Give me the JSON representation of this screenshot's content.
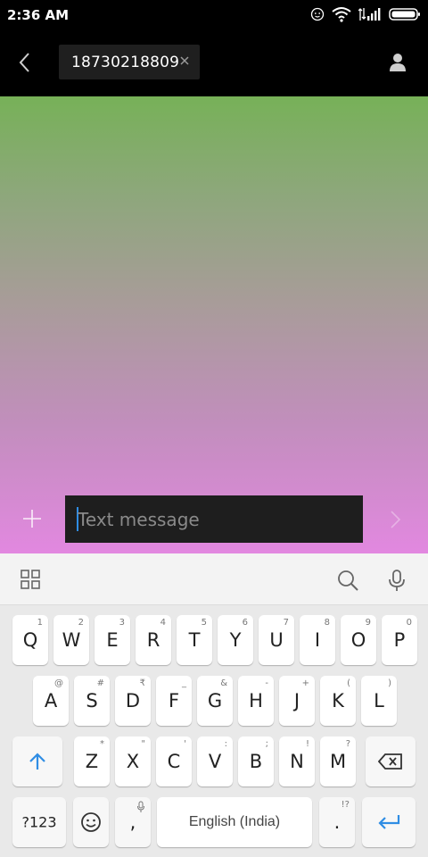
{
  "status_bar": {
    "time": "2:36 AM"
  },
  "header": {
    "recipient": "18730218809"
  },
  "composer": {
    "placeholder": "Text message"
  },
  "keyboard": {
    "row1": [
      {
        "label": "Q",
        "hint": "1"
      },
      {
        "label": "W",
        "hint": "2"
      },
      {
        "label": "E",
        "hint": "3"
      },
      {
        "label": "R",
        "hint": "4"
      },
      {
        "label": "T",
        "hint": "5"
      },
      {
        "label": "Y",
        "hint": "6"
      },
      {
        "label": "U",
        "hint": "7"
      },
      {
        "label": "I",
        "hint": "8"
      },
      {
        "label": "O",
        "hint": "9"
      },
      {
        "label": "P",
        "hint": "0"
      }
    ],
    "row2": [
      {
        "label": "A",
        "hint": "@"
      },
      {
        "label": "S",
        "hint": "#"
      },
      {
        "label": "D",
        "hint": "₹"
      },
      {
        "label": "F",
        "hint": "_"
      },
      {
        "label": "G",
        "hint": "&"
      },
      {
        "label": "H",
        "hint": "-"
      },
      {
        "label": "J",
        "hint": "+"
      },
      {
        "label": "K",
        "hint": "("
      },
      {
        "label": "L",
        "hint": ")"
      }
    ],
    "row3": [
      {
        "label": "Z",
        "hint": "*"
      },
      {
        "label": "X",
        "hint": "\""
      },
      {
        "label": "C",
        "hint": "'"
      },
      {
        "label": "V",
        "hint": ":"
      },
      {
        "label": "B",
        "hint": ";"
      },
      {
        "label": "N",
        "hint": "!"
      },
      {
        "label": "M",
        "hint": "?"
      }
    ],
    "symbols_label": "?123",
    "comma_label": ",",
    "space_label": "English (India)",
    "period_label": ".",
    "period_hint": "!?"
  }
}
